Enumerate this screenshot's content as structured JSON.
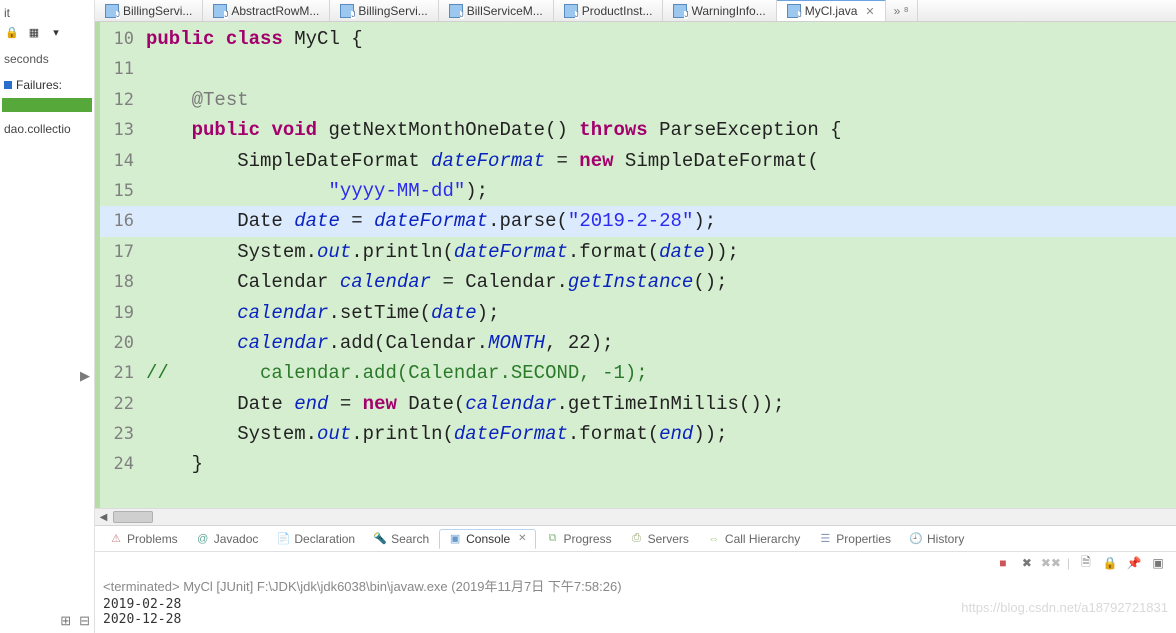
{
  "sidebar": {
    "junit_label": "it",
    "seconds": "seconds",
    "failures_label": "Failures:",
    "tree_item": "dao.collectio"
  },
  "tabs": [
    {
      "label": "BillingServi..."
    },
    {
      "label": "AbstractRowM..."
    },
    {
      "label": "BillingServi..."
    },
    {
      "label": "BillServiceM..."
    },
    {
      "label": "ProductInst..."
    },
    {
      "label": "WarningInfo..."
    },
    {
      "label": "MyCl.java"
    }
  ],
  "code": {
    "lines": [
      {
        "n": 10,
        "tokens": [
          {
            "t": "public",
            "c": "kw"
          },
          {
            "t": " "
          },
          {
            "t": "class",
            "c": "kw"
          },
          {
            "t": " MyCl {"
          }
        ]
      },
      {
        "n": 11,
        "tokens": []
      },
      {
        "n": 12,
        "tokens": [
          {
            "t": "    "
          },
          {
            "t": "@Test",
            "c": "ann"
          }
        ]
      },
      {
        "n": 13,
        "tokens": [
          {
            "t": "    "
          },
          {
            "t": "public",
            "c": "kw"
          },
          {
            "t": " "
          },
          {
            "t": "void",
            "c": "kw"
          },
          {
            "t": " getNextMonthOneDate() "
          },
          {
            "t": "throws",
            "c": "kw"
          },
          {
            "t": " ParseException {"
          }
        ]
      },
      {
        "n": 14,
        "tokens": [
          {
            "t": "        SimpleDateFormat "
          },
          {
            "t": "dateFormat",
            "c": "fld"
          },
          {
            "t": " = "
          },
          {
            "t": "new",
            "c": "kw"
          },
          {
            "t": " SimpleDateFormat("
          }
        ]
      },
      {
        "n": 15,
        "tokens": [
          {
            "t": "                "
          },
          {
            "t": "\"yyyy-MM-dd\"",
            "c": "str"
          },
          {
            "t": ");"
          }
        ]
      },
      {
        "n": 16,
        "hl": true,
        "tokens": [
          {
            "t": "        Date "
          },
          {
            "t": "date",
            "c": "fld"
          },
          {
            "t": " = "
          },
          {
            "t": "dateFormat",
            "c": "fld"
          },
          {
            "t": ".parse("
          },
          {
            "t": "\"2019-2-28\"",
            "c": "str"
          },
          {
            "t": ");"
          }
        ]
      },
      {
        "n": 17,
        "tokens": [
          {
            "t": "        System."
          },
          {
            "t": "out",
            "c": "sta"
          },
          {
            "t": ".println("
          },
          {
            "t": "dateFormat",
            "c": "fld"
          },
          {
            "t": ".format("
          },
          {
            "t": "date",
            "c": "fld"
          },
          {
            "t": "));"
          }
        ]
      },
      {
        "n": 18,
        "tokens": [
          {
            "t": "        Calendar "
          },
          {
            "t": "calendar",
            "c": "fld"
          },
          {
            "t": " = Calendar."
          },
          {
            "t": "getInstance",
            "c": "sta"
          },
          {
            "t": "();"
          }
        ]
      },
      {
        "n": 19,
        "tokens": [
          {
            "t": "        "
          },
          {
            "t": "calendar",
            "c": "fld"
          },
          {
            "t": ".setTime("
          },
          {
            "t": "date",
            "c": "fld"
          },
          {
            "t": ");"
          }
        ]
      },
      {
        "n": 20,
        "tokens": [
          {
            "t": "        "
          },
          {
            "t": "calendar",
            "c": "fld"
          },
          {
            "t": ".add(Calendar."
          },
          {
            "t": "MONTH",
            "c": "sta"
          },
          {
            "t": ", 22);"
          }
        ]
      },
      {
        "n": 21,
        "tokens": [
          {
            "t": "//        calendar.add(Calendar.SECOND, -1);",
            "c": "com"
          }
        ]
      },
      {
        "n": 22,
        "tokens": [
          {
            "t": "        Date "
          },
          {
            "t": "end",
            "c": "fld"
          },
          {
            "t": " = "
          },
          {
            "t": "new",
            "c": "kw"
          },
          {
            "t": " Date("
          },
          {
            "t": "calendar",
            "c": "fld"
          },
          {
            "t": ".getTimeInMillis());"
          }
        ]
      },
      {
        "n": 23,
        "tokens": [
          {
            "t": "        System."
          },
          {
            "t": "out",
            "c": "sta"
          },
          {
            "t": ".println("
          },
          {
            "t": "dateFormat",
            "c": "fld"
          },
          {
            "t": ".format("
          },
          {
            "t": "end",
            "c": "fld"
          },
          {
            "t": "));"
          }
        ]
      },
      {
        "n": 24,
        "tokens": [
          {
            "t": "    }"
          }
        ]
      }
    ]
  },
  "bottom_tabs": [
    {
      "label": "Problems",
      "icon": "⚠",
      "color": "#c88"
    },
    {
      "label": "Javadoc",
      "icon": "@",
      "color": "#6a9"
    },
    {
      "label": "Declaration",
      "icon": "📄",
      "color": "#aa8"
    },
    {
      "label": "Search",
      "icon": "🔦",
      "color": "#c96"
    },
    {
      "label": "Console",
      "icon": "▣",
      "color": "#69c",
      "active": true
    },
    {
      "label": "Progress",
      "icon": "⧉",
      "color": "#8b8"
    },
    {
      "label": "Servers",
      "icon": "⎙",
      "color": "#9a7"
    },
    {
      "label": "Call Hierarchy",
      "icon": "⇔",
      "color": "#9c7"
    },
    {
      "label": "Properties",
      "icon": "☰",
      "color": "#89b"
    },
    {
      "label": "History",
      "icon": "🕘",
      "color": "#caa"
    }
  ],
  "console": {
    "status": "<terminated> MyCl [JUnit] F:\\JDK\\jdk\\jdk6038\\bin\\javaw.exe (2019年11月7日 下午7:58:26)",
    "lines": [
      "2019-02-28",
      "2020-12-28"
    ]
  },
  "watermark": "https://blog.csdn.net/a18792721831"
}
